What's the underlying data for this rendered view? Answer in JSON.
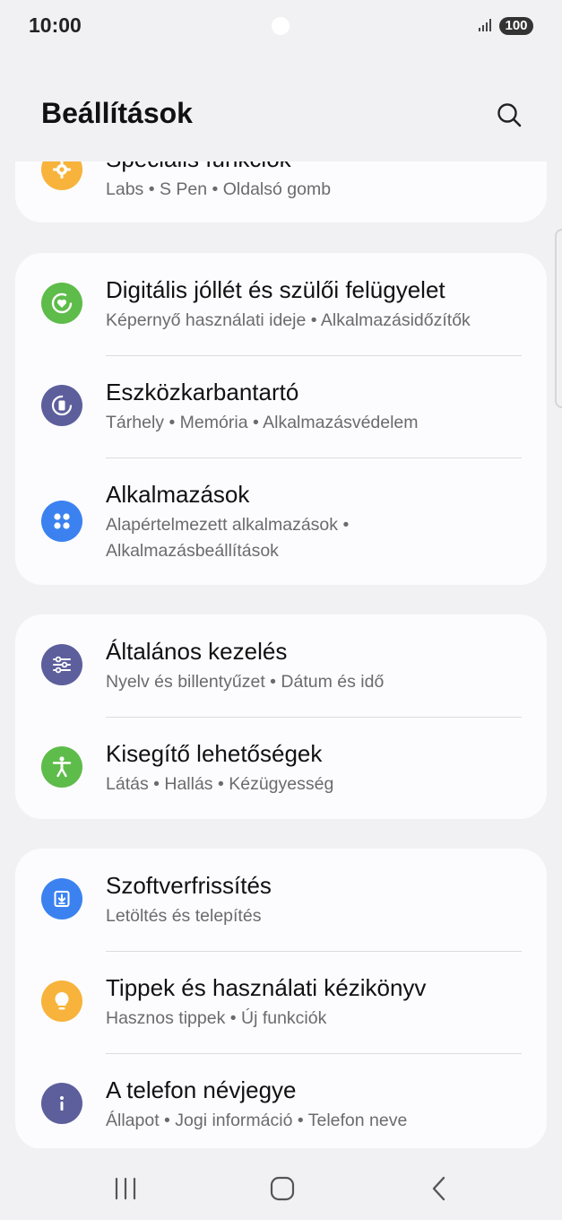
{
  "status": {
    "time": "10:00",
    "battery": "100"
  },
  "header": {
    "title": "Beállítások"
  },
  "cards": [
    {
      "items": [
        {
          "title": "Speciális funkciók",
          "subtitle": "Labs • S Pen • Oldalsó gomb",
          "icon": "gear-icon",
          "color": "#f7b33b"
        }
      ]
    },
    {
      "items": [
        {
          "title": "Digitális jóllét és szülői felügyelet",
          "subtitle": "Képernyő használati ideje • Alkalmazásidőzítők",
          "icon": "heart-circle-icon",
          "color": "#5ebc4a"
        },
        {
          "title": "Eszközkarbantartó",
          "subtitle": "Tárhely • Memória • Alkalmazásvédelem",
          "icon": "maintenance-icon",
          "color": "#5d5f9c"
        },
        {
          "title": "Alkalmazások",
          "subtitle": "Alapértelmezett alkalmazások • Alkalmazásbeállítások",
          "icon": "apps-grid-icon",
          "color": "#3b82f0"
        }
      ]
    },
    {
      "items": [
        {
          "title": "Általános kezelés",
          "subtitle": "Nyelv és billentyűzet • Dátum és idő",
          "icon": "sliders-icon",
          "color": "#5d5f9c"
        },
        {
          "title": "Kisegítő lehetőségek",
          "subtitle": "Látás • Hallás • Kézügyesség",
          "icon": "accessibility-icon",
          "color": "#5ebc4a"
        }
      ]
    },
    {
      "items": [
        {
          "title": "Szoftverfrissítés",
          "subtitle": "Letöltés és telepítés",
          "icon": "download-icon",
          "color": "#3b82f0"
        },
        {
          "title": "Tippek és használati kézikönyv",
          "subtitle": "Hasznos tippek • Új funkciók",
          "icon": "lightbulb-icon",
          "color": "#f7b33b"
        },
        {
          "title": "A telefon névjegye",
          "subtitle": "Állapot • Jogi információ • Telefon neve",
          "icon": "info-icon",
          "color": "#5d5f9c"
        }
      ]
    }
  ],
  "nav": {
    "recents": "recents-icon",
    "home": "home-icon",
    "back": "back-icon"
  }
}
